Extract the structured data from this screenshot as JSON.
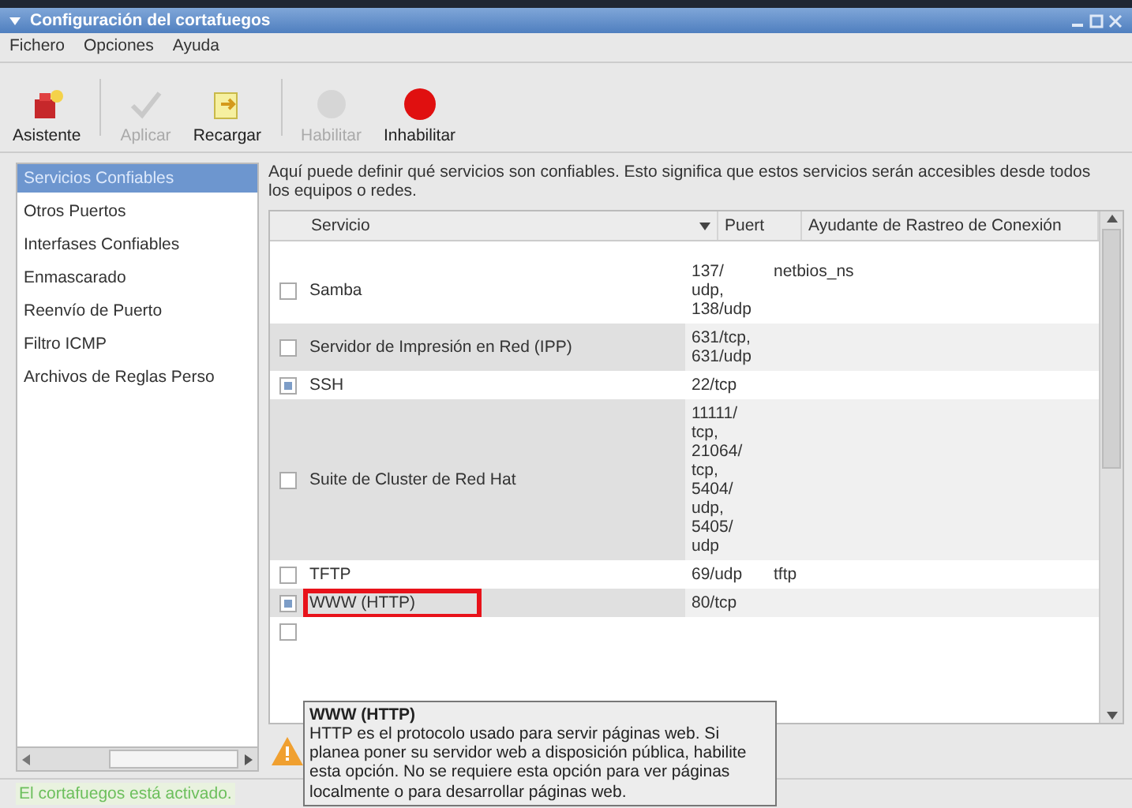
{
  "window": {
    "title": "Configuración del cortafuegos"
  },
  "menu": [
    "Fichero",
    "Opciones",
    "Ayuda"
  ],
  "toolbar": [
    {
      "kind": "wizard",
      "label": "Asistente",
      "disabled": false
    },
    {
      "kind": "separator"
    },
    {
      "kind": "apply",
      "label": "Aplicar",
      "disabled": true
    },
    {
      "kind": "reload",
      "label": "Recargar",
      "disabled": false
    },
    {
      "kind": "separator"
    },
    {
      "kind": "enable",
      "label": "Habilitar",
      "disabled": true
    },
    {
      "kind": "disable",
      "label": "Inhabilitar",
      "disabled": false
    }
  ],
  "sidebar": {
    "items": [
      {
        "label": "Servicios Confiables",
        "selected": true
      },
      {
        "label": "Otros Puertos",
        "selected": false
      },
      {
        "label": "Interfases Confiables",
        "selected": false
      },
      {
        "label": "Enmascarado",
        "selected": false
      },
      {
        "label": "Reenvío de Puerto",
        "selected": false
      },
      {
        "label": "Filtro ICMP",
        "selected": false
      },
      {
        "label": "Archivos de Reglas Perso",
        "selected": false
      }
    ]
  },
  "description": "Aquí puede definir qué servicios son confiables. Esto significa que estos servicios serán accesibles desde todos los equipos o redes.",
  "table": {
    "columns": [
      "Servicio",
      "Puert",
      "Ayudante de Rastreo de Conexión"
    ],
    "rows": [
      {
        "service": "Samba",
        "port_lines": [
          "137/",
          "udp,",
          "138/udp"
        ],
        "helper": "netbios_ns",
        "checked": false,
        "highlighted": false
      },
      {
        "service": "Servidor de Impresión en Red (IPP)",
        "port_lines": [
          "631/tcp,",
          "631/udp"
        ],
        "checked": false,
        "highlighted": false
      },
      {
        "service": "SSH",
        "port_lines": [
          "22/tcp"
        ],
        "checked": true,
        "highlighted": false
      },
      {
        "service": "Suite de Cluster de Red Hat",
        "port_lines": [
          "11111/",
          "tcp,",
          "21064/",
          "tcp,",
          "5404/",
          "udp,",
          "5405/",
          "udp"
        ],
        "checked": false,
        "highlighted": false
      },
      {
        "service": "TFTP",
        "port_lines": [
          "69/udp"
        ],
        "helper": "tftp",
        "checked": false,
        "highlighted": false
      },
      {
        "service": "WWW (HTTP)",
        "port_lines": [
          "80/tcp"
        ],
        "checked": true,
        "highlighted": true
      },
      {
        "checked": false,
        "highlighted": false
      }
    ]
  },
  "tooltip": {
    "title": "WWW (HTTP)",
    "text": "HTTP es el protocolo usado para servir páginas web. Si planea poner su servidor web a disposición pública, habilite esta opción. No se requiere esta opción para ver páginas localmente o para desarrollar páginas web."
  },
  "status_bar": "El cortafuegos está activado."
}
